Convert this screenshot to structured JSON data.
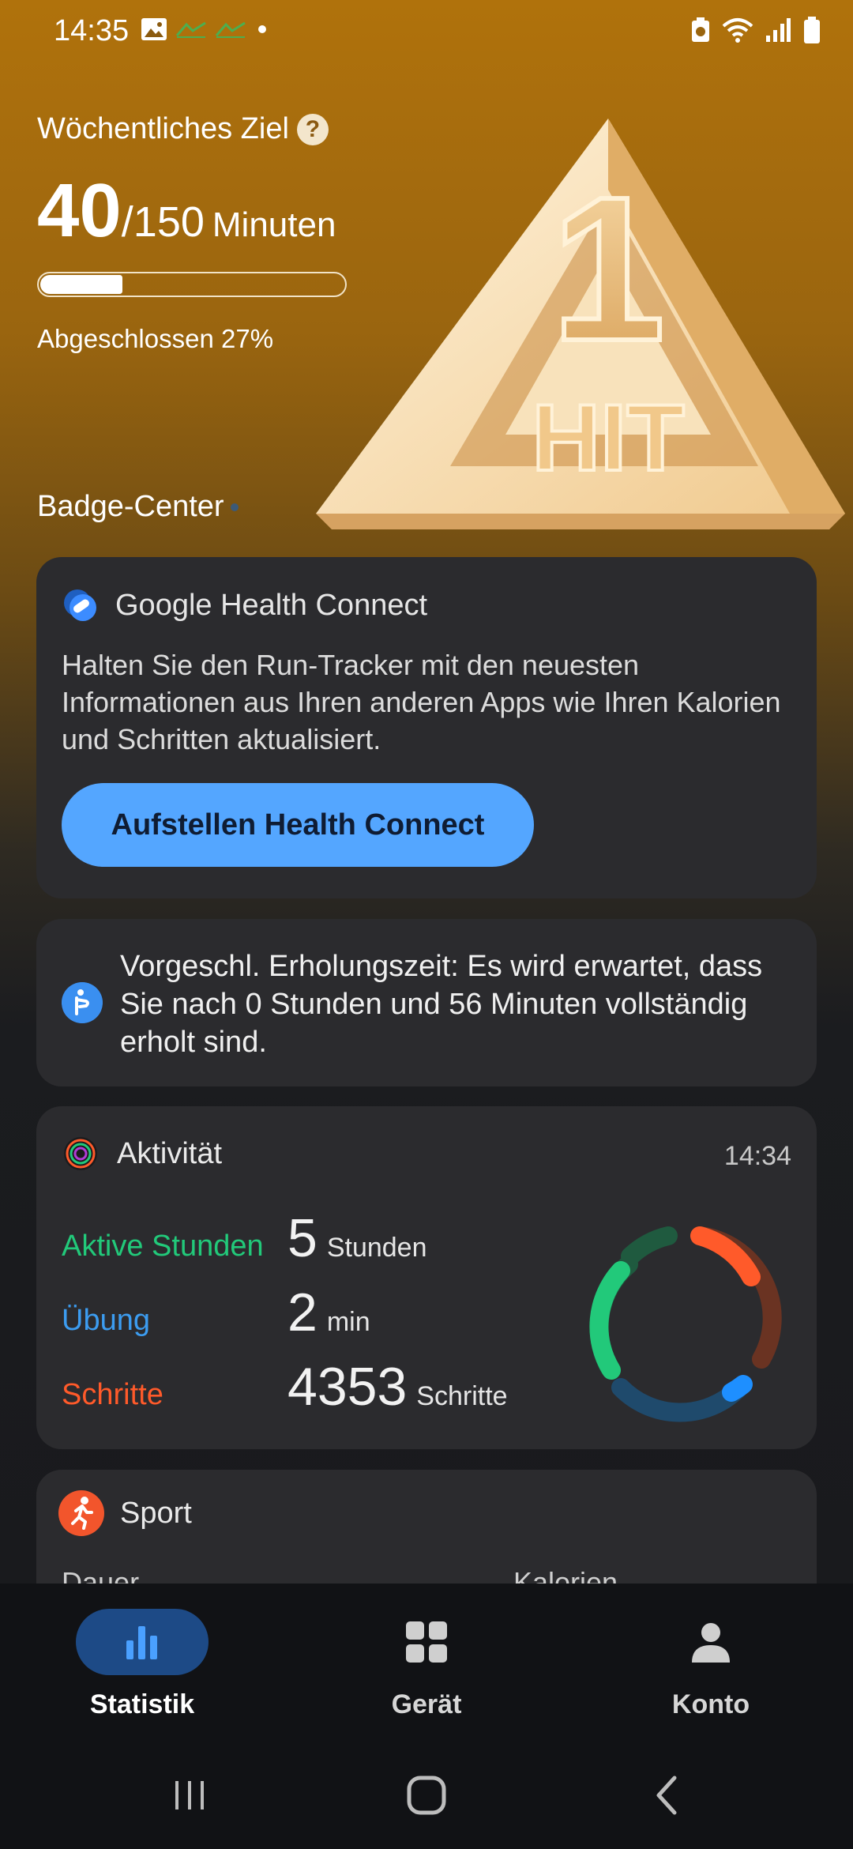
{
  "status_bar": {
    "time": "14:35"
  },
  "weekly_goal": {
    "title": "Wöchentliches Ziel",
    "help": "?",
    "current": "40",
    "target": "/150",
    "unit": "Minuten",
    "progress_fraction": 0.27,
    "completed_text": "Abgeschlossen 27%",
    "badge_center": "Badge-Center",
    "badge_text_number": "1",
    "badge_text_word": "HIT"
  },
  "health_connect": {
    "title": "Google Health Connect",
    "description": "Halten Sie den Run-Tracker mit den neuesten Informationen aus Ihren anderen Apps wie Ihren Kalorien und Schritten aktualisiert.",
    "button_label": "Aufstellen Health Connect"
  },
  "recovery": {
    "text": "Vorgeschl. Erholungszeit: Es wird erwartet, dass Sie nach 0 Stunden und 56 Minuten vollständig erholt sind."
  },
  "activity": {
    "title": "Aktivität",
    "time": "14:34",
    "metrics": [
      {
        "label": "Aktive Stunden",
        "value": "5",
        "unit": "Stunden",
        "color": "#22c97a"
      },
      {
        "label": "Übung",
        "value": "2",
        "unit": "min",
        "color": "#3c9cf0"
      },
      {
        "label": "Schritte",
        "value": "4353",
        "unit": "Schritte",
        "color": "#ff5a2a"
      }
    ]
  },
  "sport": {
    "title": "Sport",
    "col_left": "Dauer",
    "col_right": "Kalorien"
  },
  "bottom_nav": {
    "items": [
      {
        "label": "Statistik",
        "icon": "bar-chart-icon",
        "active": true
      },
      {
        "label": "Gerät",
        "icon": "grid-icon",
        "active": false
      },
      {
        "label": "Konto",
        "icon": "person-icon",
        "active": false
      }
    ]
  },
  "colors": {
    "accent_blue": "#54a6ff",
    "card_bg": "#2b2b2e",
    "hero_gold": "#b0720c"
  }
}
